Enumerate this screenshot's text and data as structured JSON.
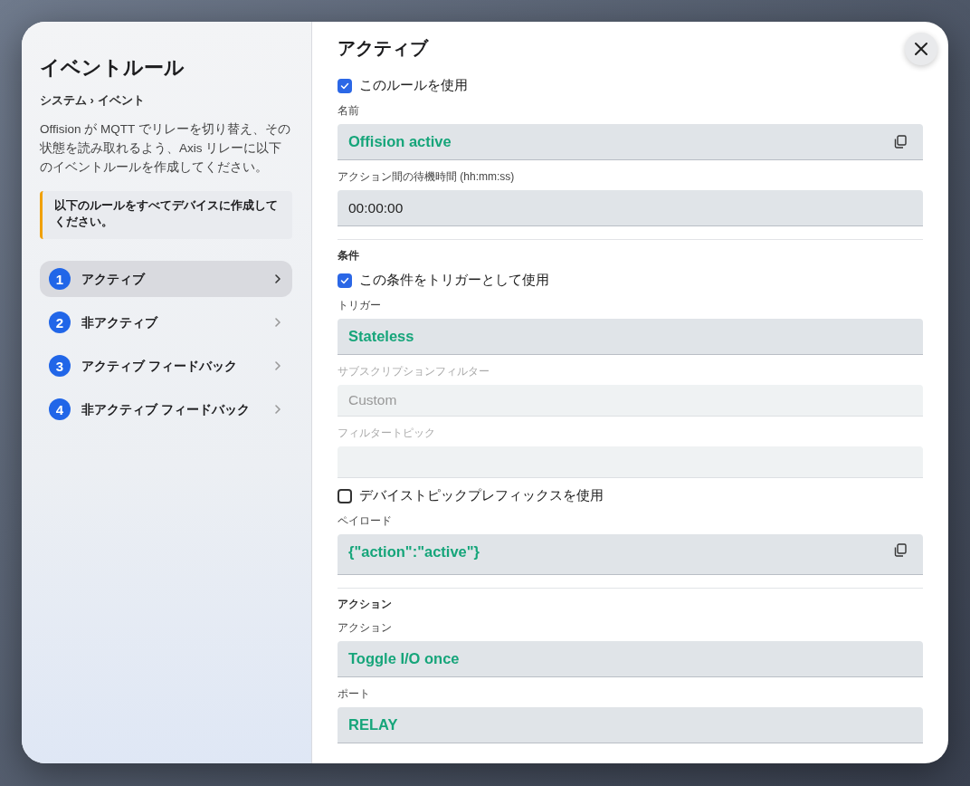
{
  "sidebar": {
    "title": "イベントルール",
    "breadcrumb": "システム › イベント",
    "description": "Offision が MQTT でリレーを切り替え、その状態を読み取れるよう、Axis リレーに以下のイベントルールを作成してください。",
    "notice": "以下のルールをすべてデバイスに作成してください。",
    "steps": [
      {
        "number": "1",
        "label": "アクティブ",
        "selected": true
      },
      {
        "number": "2",
        "label": "非アクティブ",
        "selected": false
      },
      {
        "number": "3",
        "label": "アクティブ フィードバック",
        "selected": false
      },
      {
        "number": "4",
        "label": "非アクティブ フィードバック",
        "selected": false
      }
    ]
  },
  "panel": {
    "title": "アクティブ",
    "items": [
      {
        "kind": "checkbox",
        "label": "このルールを使用",
        "checked": true
      },
      {
        "kind": "field",
        "label": "名前",
        "value": "Offision active",
        "highlighted": true,
        "copy": true,
        "disabled": false
      },
      {
        "kind": "field",
        "label": "アクション間の待機時間 (hh:mm:ss)",
        "value": "00:00:00",
        "highlighted": false,
        "copy": false,
        "disabled": false
      },
      {
        "kind": "section",
        "label": "条件"
      },
      {
        "kind": "checkbox",
        "label": "この条件をトリガーとして使用",
        "checked": true
      },
      {
        "kind": "field",
        "label": "トリガー",
        "value": "Stateless",
        "highlighted": true,
        "copy": false,
        "disabled": false
      },
      {
        "kind": "field",
        "label": "サブスクリプションフィルター",
        "value": "Custom",
        "highlighted": false,
        "copy": false,
        "disabled": true
      },
      {
        "kind": "field",
        "label": "フィルタートピック",
        "highlighted": false,
        "copy": false,
        "disabled": true
      },
      {
        "kind": "checkbox",
        "label": "デバイストピックプレフィックスを使用",
        "checked": false
      },
      {
        "kind": "field",
        "label": "ペイロード",
        "value": "{\"action\":\"active\"}",
        "highlighted": true,
        "copy": true,
        "disabled": false,
        "tall": true
      },
      {
        "kind": "section",
        "label": "アクション"
      },
      {
        "kind": "field",
        "label": "アクション",
        "value": "Toggle I/O once",
        "highlighted": true,
        "copy": false,
        "disabled": false
      },
      {
        "kind": "field",
        "label": "ポート",
        "value": "RELAY",
        "highlighted": true,
        "copy": false,
        "disabled": false
      }
    ]
  }
}
